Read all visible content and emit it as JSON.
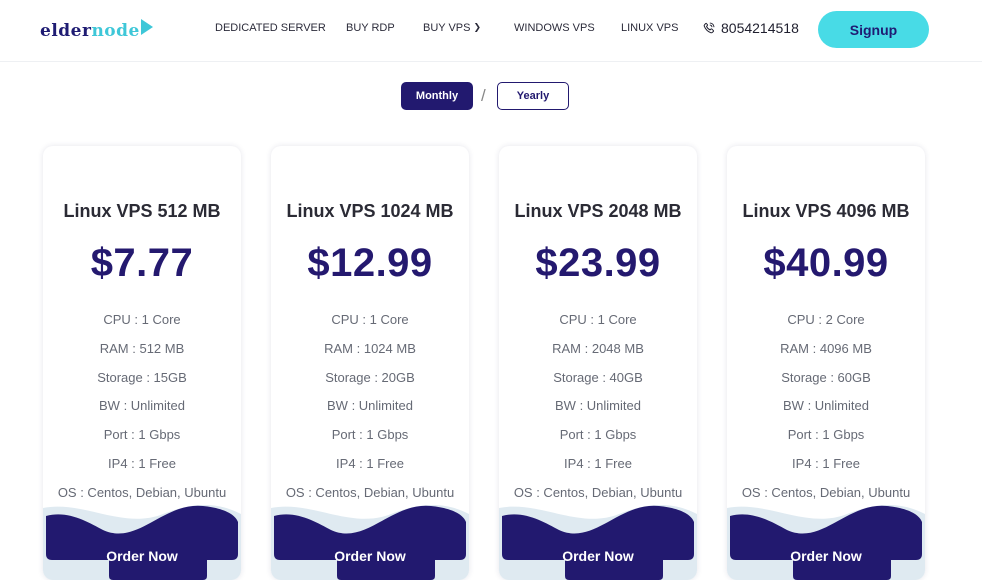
{
  "header": {
    "logo": {
      "part1": "elder",
      "part2": "node"
    },
    "nav": [
      {
        "label": "DEDICATED SERVER"
      },
      {
        "label": "BUY RDP"
      },
      {
        "label": "BUY VPS"
      },
      {
        "label": "WINDOWS VPS"
      },
      {
        "label": "LINUX VPS"
      }
    ],
    "phone": "8054214518",
    "signup_label": "Signup"
  },
  "billing_toggle": {
    "monthly": "Monthly",
    "separator": "/",
    "yearly": "Yearly",
    "selected": "Monthly"
  },
  "plans": [
    {
      "title": "Linux VPS 512 MB",
      "price": "$7.77",
      "features": [
        "CPU : 1 Core",
        "RAM : 512 MB",
        "Storage : 15GB",
        "BW : Unlimited",
        "Port : 1 Gbps",
        "IP4 : 1 Free",
        "OS : Centos, Debian, Ubuntu"
      ],
      "button": "Order Now"
    },
    {
      "title": "Linux VPS 1024 MB",
      "price": "$12.99",
      "features": [
        "CPU : 1 Core",
        "RAM : 1024 MB",
        "Storage : 20GB",
        "BW : Unlimited",
        "Port : 1 Gbps",
        "IP4 : 1 Free",
        "OS : Centos, Debian, Ubuntu"
      ],
      "button": "Order Now"
    },
    {
      "title": "Linux VPS 2048 MB",
      "price": "$23.99",
      "features": [
        "CPU : 1 Core",
        "RAM : 2048 MB",
        "Storage : 40GB",
        "BW : Unlimited",
        "Port : 1 Gbps",
        "IP4 : 1 Free",
        "OS : Centos, Debian, Ubuntu"
      ],
      "button": "Order Now"
    },
    {
      "title": "Linux VPS 4096 MB",
      "price": "$40.99",
      "features": [
        "CPU : 2 Core",
        "RAM : 4096 MB",
        "Storage : 60GB",
        "BW : Unlimited",
        "Port : 1 Gbps",
        "IP4 : 1 Free",
        "OS : Centos, Debian, Ubuntu"
      ],
      "button": "Order Now"
    }
  ],
  "colors": {
    "brand_navy": "#22196f",
    "accent_cyan": "#48dbe6",
    "wave_light": "#dfeaf1"
  }
}
